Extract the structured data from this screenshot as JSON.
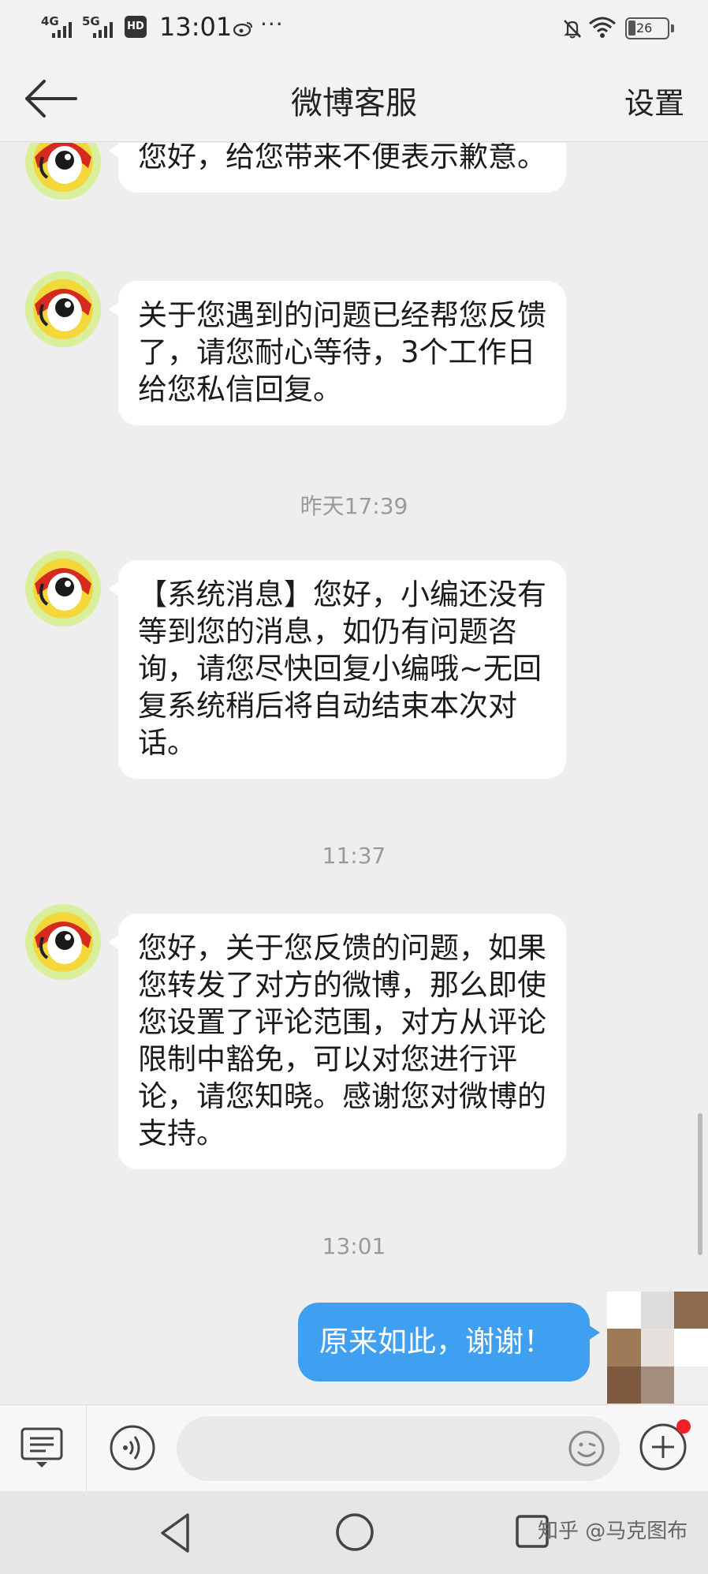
{
  "status_bar": {
    "net1": "4G",
    "net2": "5G",
    "hd": "HD",
    "time": "13:01",
    "more": "···",
    "battery": "26",
    "icons": [
      "signal-icon",
      "hd-icon",
      "weibo-icon",
      "mute-bell-icon",
      "wifi-icon",
      "battery-icon"
    ]
  },
  "nav": {
    "title": "微博客服",
    "settings": "设置"
  },
  "chat": {
    "messages": [
      {
        "text": "您好，给您带来不便表示歉意。"
      },
      {
        "text": "关于您遇到的问题已经帮您反馈了，请您耐心等待，3个工作日给您私信回复。"
      },
      {
        "text": "【系统消息】您好，小编还没有等到您的消息，如仍有问题咨询，请您尽快回复小编哦~无回复系统稍后将自动结束本次对话。"
      },
      {
        "text": "您好，关于您反馈的问题，如果您转发了对方的微博，那么即使您设置了评论范围，对方从评论限制中豁免，可以对您进行评论，请您知晓。感谢您对微博的支持。"
      }
    ],
    "timestamps": [
      "昨天17:39",
      "11:37",
      "13:01"
    ],
    "my_message": "原来如此，谢谢！"
  },
  "input_bar": {
    "placeholder": "",
    "icons": [
      "keyboard-menu-icon",
      "voice-icon",
      "emoji-icon",
      "plus-icon"
    ]
  },
  "system_nav": {
    "watermark": "知乎 @马克图布"
  },
  "colors": {
    "my_bubble": "#3fa0f2",
    "background": "#eeeeee",
    "badge": "#f01f29"
  }
}
